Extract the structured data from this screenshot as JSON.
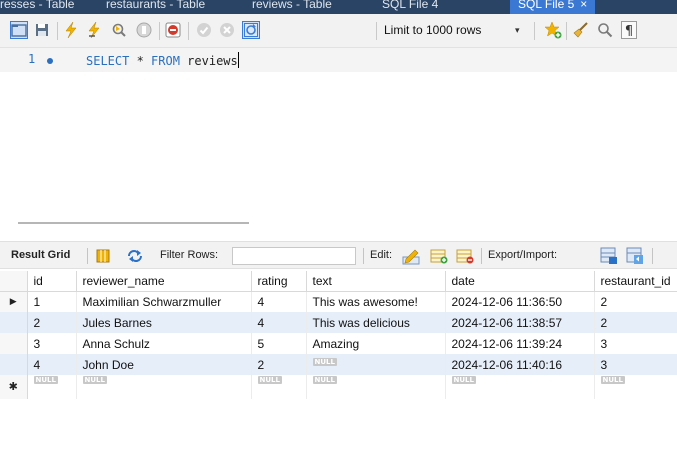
{
  "tabs": [
    {
      "label": "resses - Table"
    },
    {
      "label": "restaurants - Table"
    },
    {
      "label": "reviews - Table"
    },
    {
      "label": "SQL File 4"
    },
    {
      "label": "SQL File 5",
      "close": "×",
      "active": true
    }
  ],
  "toolbar": {
    "limit_label": "Limit to 1000 rows",
    "limit_arrow": "▾"
  },
  "editor": {
    "line_number": "1",
    "code_keywords": [
      "SELECT",
      "FROM"
    ],
    "code_star": " * ",
    "code_table": " reviews"
  },
  "result_toolbar": {
    "result_grid_label": "Result Grid",
    "filter_label": "Filter Rows:",
    "filter_value": "",
    "edit_label": "Edit:",
    "export_label": "Export/Import:"
  },
  "grid": {
    "columns": [
      "id",
      "reviewer_name",
      "rating",
      "text",
      "date",
      "restaurant_id"
    ],
    "null_label": "NULL",
    "current_row_marker": "▶",
    "new_row_marker": "✱",
    "rows": [
      [
        "1",
        "Maximilian Schwarzmuller",
        "4",
        "This was awesome!",
        "2024-12-06 11:36:50",
        "2"
      ],
      [
        "2",
        "Jules Barnes",
        "4",
        "This was delicious",
        "2024-12-06 11:38:57",
        "2"
      ],
      [
        "3",
        "Anna Schulz",
        "5",
        "Amazing",
        "2024-12-06 11:39:24",
        "3"
      ],
      [
        "4",
        "John Doe",
        "2",
        "",
        "2024-12-06 11:40:16",
        "3"
      ]
    ]
  },
  "colors": {
    "tab_bar": "#2a4466",
    "tab_active": "#3a78d4",
    "keyword": "#2a6fc0",
    "row_alt": "#e6eef9"
  }
}
